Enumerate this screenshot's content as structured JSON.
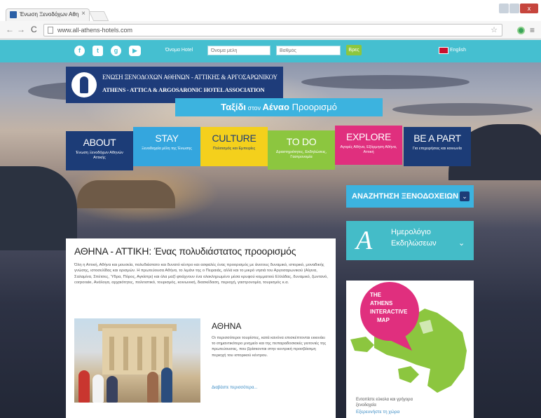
{
  "browser": {
    "tab_title": "Ένωση Ξενοδόχων Αθη",
    "tab_close": "×",
    "url": "www.all-athens-hotels.com",
    "win_close": "x",
    "nav_back": "←",
    "nav_forward": "→",
    "nav_reload": "C",
    "star": "☆",
    "menu": "≡"
  },
  "topbar": {
    "social": [
      "f",
      "t",
      "g",
      "▶"
    ],
    "search_label": "Όνομα Hotel",
    "search_placeholder_1": "Όνομα μέλη",
    "search_placeholder_2": "Βαθμός",
    "search_button": "Βρες",
    "language": "English"
  },
  "logo": {
    "line1": "ΕΝΩΣΗ ΞΕΝΟΔΟΧΩΝ ΑΘΗΝΩΝ - ΑΤΤΙΚΗΣ & ΑΡΓΟΣΑΡΩΝΙΚΟΥ",
    "line2": "ATHENS - ATTICA & ARGOSARONIC HOTEL ASSOCIATION"
  },
  "tagline": {
    "part1": "Ταξίδι",
    "part2": " στον ",
    "part3": "Αέναο",
    "part4": " Προορισμό"
  },
  "categories": [
    {
      "title": "ABOUT",
      "sub": "Ένωση Ξενοδόχων Αθηνών Αττικής"
    },
    {
      "title": "STAY",
      "sub": "Ξενοδοχεία μέλη της Ένωσης"
    },
    {
      "title": "CULTURE",
      "sub": "Πολιτισμός και Εμπειρίες"
    },
    {
      "title": "TO DO",
      "sub": "Δραστηριότητες, Εκδηλώσεις, Γαστρονομία"
    },
    {
      "title": "EXPLORE",
      "sub": "Αγορές Αθήνα, Εξόρμηση Αθήνα, Αττική"
    },
    {
      "title": "BE A PART",
      "sub": "Για επιχειρήσεις και κοινωνία"
    }
  ],
  "hotel_search": {
    "label": "ΑΝΑΖΗΤΗΣΗ ΞΕΝΟΔΟΧΕΙΩΝ",
    "chevron": "⌄"
  },
  "events": {
    "glyph": "A",
    "line1": "Ημερολόγιο",
    "line2": "Εκδηλώσεων",
    "chevron": "⌄"
  },
  "map": {
    "badge_line1": "THE",
    "badge_line2": "ATHENS",
    "badge_line3": "INTERACTIVE",
    "badge_line4": "MAP",
    "caption": "Εντοπίστε εύκολα και γρήγορα ξενοδοχεία",
    "link": "Εξερευνήστε τη χώρα"
  },
  "content": {
    "title": "ΑΘΗΝΑ - ΑΤΤΙΚΗ: Ένας πολυδιάστατος προορισμός",
    "body": "Όλη η Αττική, Αθήνα και μουσεία, πολυδιάστατο και δυνατό κέντρο και ασφαλές ένας προορισμός με άνετους δυναμικό, ιστορικό, μοναδικής γνώσης, ιστοσελίδας και ορισμών. Η πρωτεύουσα Αθήνα, το λιμάνι της ο Πειραιάς, αλλά και το μικρό νησιά του Αργοσαρωνικού (Αίγινα, Σαλαμίνα, Σπέτσες, Ύδρα, Πόρος, Αγκίστρι) και όλα μαζί φτιάχνουν ένα ολοκληρωμένο μέσα κρυφού κομματιού Ελλάδας, δυναμικό, ζωντανό, corporate, Ανάλογα, αρχαιότητες, πολιτιστικό, τουρισμός, κοινωνική, διασκέδαση, περιοχή, γαστρονομία, τουρισμός κ.α.",
    "sub_title": "ΑΘΗΝΑ",
    "sub_body": "Οι περισσότεροι τουρίστες, κατά κανόνα επισκέπτονται εκκινάει το σημαντικότερο μνημείο και της πεπαραδοσιακές γειτονιές της πρωτεύουσας, που βρίσκονται στην κεντρική προσβάσιμη περιοχή του ιστορικού κέντρου.",
    "sub_link": "Διαβάστε περισσότερα..."
  },
  "colors": {
    "topbar": "#45bfd0",
    "navy": "#1c3c77",
    "blue": "#34a6de",
    "yellow": "#f4d01c",
    "green": "#8cc63f",
    "magenta": "#e02f7e"
  },
  "icons": [
    "facebook-icon",
    "twitter-icon",
    "google-plus-icon",
    "youtube-icon",
    "flag-icon",
    "chevron-down-icon",
    "star-icon",
    "menu-icon"
  ]
}
